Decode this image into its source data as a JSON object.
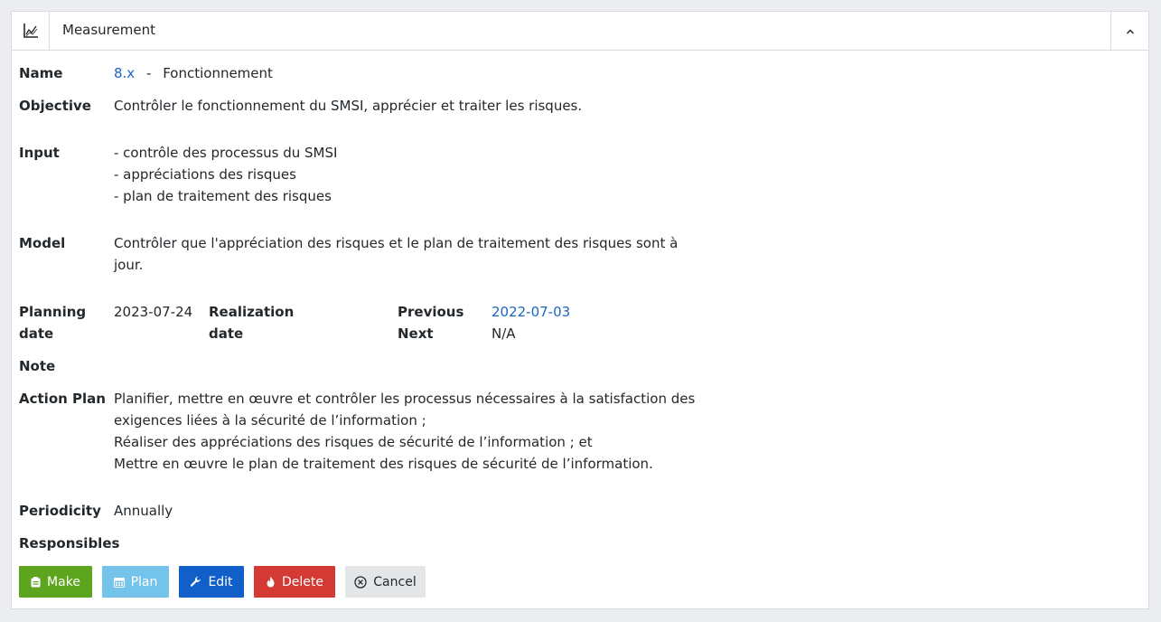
{
  "header": {
    "title": "Measurement",
    "icon": "chart-line-icon",
    "collapse_icon": "chevron-up-icon"
  },
  "labels": {
    "name": "Name",
    "objective": "Objective",
    "input": "Input",
    "model": "Model",
    "planning_line1": "Planning",
    "planning_line2": "date",
    "realization_line1": "Realization",
    "realization_line2": "date",
    "previous": "Previous",
    "next": "Next",
    "note": "Note",
    "action_plan": "Action Plan",
    "periodicity": "Periodicity",
    "responsibles": "Responsibles"
  },
  "values": {
    "name_code": "8.x",
    "name_separator": "-",
    "name_title": "Fonctionnement",
    "objective": "Contrôler le fonctionnement du SMSI, apprécier et traiter les risques.",
    "input_lines": [
      "- contrôle des processus du SMSI",
      "- appréciations des risques",
      "- plan de traitement des risques"
    ],
    "model_lines": [
      "Contrôler que l'appréciation des risques et le plan de traitement des risques sont à",
      "jour."
    ],
    "planning_date": "2023-07-24",
    "previous_date": "2022-07-03",
    "next_value": "N/A",
    "action_plan_lines": [
      "Planifier, mettre en œuvre et contrôler les processus nécessaires à la satisfaction des",
      "exigences liées à la sécurité de l’information ;",
      "Réaliser des appréciations des risques de sécurité de l’information ; et",
      "Mettre en œuvre le plan de traitement des risques de sécurité de l’information."
    ],
    "periodicity": "Annually"
  },
  "buttons": {
    "make": {
      "label": "Make",
      "icon": "clipboard-icon",
      "color": "#5ea51f"
    },
    "plan": {
      "label": "Plan",
      "icon": "calendar-icon",
      "color": "#73c3ea"
    },
    "edit": {
      "label": "Edit",
      "icon": "wrench-icon",
      "color": "#1160c9"
    },
    "delete": {
      "label": "Delete",
      "icon": "fire-icon",
      "color": "#d43a34"
    },
    "cancel": {
      "label": "Cancel",
      "icon": "x-circle-icon",
      "color": "#e4e6e8"
    }
  }
}
